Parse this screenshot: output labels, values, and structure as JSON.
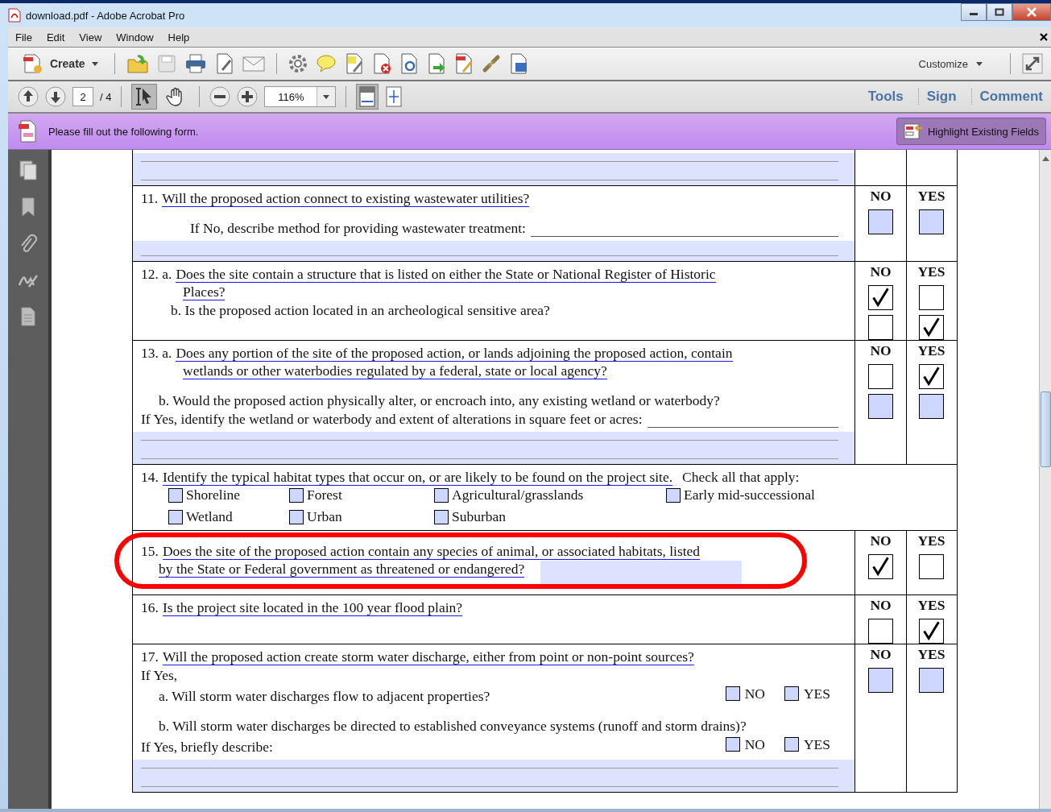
{
  "window": {
    "title": "download.pdf - Adobe Acrobat Pro"
  },
  "menu": [
    "File",
    "Edit",
    "View",
    "Window",
    "Help"
  ],
  "toolbar": {
    "create": "Create",
    "customize": "Customize"
  },
  "nav": {
    "page": "2",
    "total": "/ 4",
    "zoom": "116%",
    "select_tool_selected": true
  },
  "panes": [
    "Tools",
    "Sign",
    "Comment"
  ],
  "notice": {
    "text": "Please fill out the following form.",
    "button": "Highlight Existing Fields"
  },
  "form": [
    {
      "kind": "field_only",
      "lines": [
        {
          "kind": "field"
        },
        {
          "kind": "field"
        }
      ]
    },
    {
      "kind": "question",
      "headers": [
        "NO",
        "YES"
      ],
      "lines": [
        {
          "kind": "lead",
          "prefix": "11.",
          "text": "Will the proposed action connect to existing wastewater utilities?",
          "underlined": true
        },
        {
          "kind": "deep",
          "text": "If  No, describe method for providing wastewater treatment:",
          "underlined": false,
          "fill_line": true
        },
        {
          "kind": "field"
        }
      ],
      "answers": [
        {
          "no": false,
          "yes": false
        }
      ]
    },
    {
      "kind": "question",
      "headers": [
        "NO",
        "YES"
      ],
      "lines": [
        {
          "kind": "lead",
          "prefix": "12.  a.",
          "text": "Does the site contain a structure that is listed on either the State or National Register of Historic",
          "underlined": true
        },
        {
          "kind": "cont",
          "text": "Places?",
          "underlined": true
        },
        {
          "kind": "mid",
          "text": "b. Is the proposed action located in an archeological sensitive area?",
          "underlined": false
        }
      ],
      "answers": [
        {
          "no": true,
          "yes": false
        },
        {
          "no": false,
          "yes": true
        }
      ]
    },
    {
      "kind": "question",
      "headers": [
        "NO",
        "YES"
      ],
      "lines": [
        {
          "kind": "lead",
          "prefix": "13. a.",
          "text": "Does any portion of the site of the proposed action, or lands adjoining the proposed action, contain",
          "underlined": true
        },
        {
          "kind": "cont",
          "text": "wetlands or other waterbodies regulated by a federal, state or local agency?",
          "underlined": true
        },
        {
          "kind": "sub_spaced",
          "text": "b. Would the proposed action physically alter, or encroach into, any existing wetland or waterbody?",
          "underlined": false
        },
        {
          "kind": "plain",
          "text": "If Yes, identify the wetland or waterbody and extent of alterations in square feet or acres:",
          "underlined": false,
          "fill_line": true
        },
        {
          "kind": "field"
        },
        {
          "kind": "field"
        }
      ],
      "answers": [
        {
          "no": false,
          "yes": true
        },
        {
          "no": false,
          "yes": false
        }
      ]
    },
    {
      "kind": "checklist",
      "lines": [
        {
          "kind": "lead",
          "prefix": "14.",
          "text": "Identify the typical habitat types that occur on, or are likely to be found on the project site.",
          "underlined": true,
          "suffix": "Check all that apply:"
        }
      ],
      "options": [
        {
          "label": "Shoreline",
          "checked": false
        },
        {
          "label": "Forest",
          "checked": false
        },
        {
          "label": "Agricultural/grasslands",
          "checked": false
        },
        {
          "label": "Early mid-successional",
          "checked": false
        },
        {
          "label": "Wetland",
          "checked": false
        },
        {
          "label": "Urban",
          "checked": false
        },
        {
          "label": "Suburban",
          "checked": false
        }
      ]
    },
    {
      "kind": "question",
      "headers": [
        "NO",
        "YES"
      ],
      "circled": true,
      "lines": [
        {
          "kind": "lead",
          "prefix": "15.",
          "text": "Does the site of the proposed action contain any species of animal, or associated habitats, listed",
          "underlined": true
        },
        {
          "kind": "sub",
          "text": "by the State or Federal government as threatened or endangered?",
          "underlined": true,
          "inline_field": true
        }
      ],
      "answers": [
        {
          "no": true,
          "yes": false
        }
      ]
    },
    {
      "kind": "question",
      "headers": [
        "NO",
        "YES"
      ],
      "lines": [
        {
          "kind": "lead",
          "prefix": "16.",
          "text": "Is the project site located in the 100 year flood plain?",
          "underlined": true
        }
      ],
      "answers": [
        {
          "no": false,
          "yes": true
        }
      ]
    },
    {
      "kind": "question",
      "headers": [
        "NO",
        "YES"
      ],
      "lines": [
        {
          "kind": "lead",
          "prefix": "17.",
          "text": "Will the proposed action create storm water discharge, either from point or non-point sources?",
          "underlined": true
        },
        {
          "kind": "plain",
          "text": "If Yes,",
          "underlined": false
        },
        {
          "kind": "sub",
          "text": "a. Will storm water discharges flow to adjacent properties?",
          "underlined": false,
          "choices": [
            {
              "label": "NO",
              "checked": false
            },
            {
              "label": "YES",
              "checked": false
            }
          ]
        },
        {
          "kind": "sub_spaced",
          "text": "b. Will storm water discharges be directed to established conveyance systems (runoff and storm drains)?",
          "underlined": false
        },
        {
          "kind": "plain",
          "text": "If Yes, briefly describe:",
          "underlined": false,
          "choices": [
            {
              "label": "NO",
              "checked": false
            },
            {
              "label": "YES",
              "checked": false
            }
          ]
        },
        {
          "kind": "field"
        },
        {
          "kind": "field"
        }
      ],
      "answers": [
        {
          "no": false,
          "yes": false
        }
      ]
    }
  ]
}
